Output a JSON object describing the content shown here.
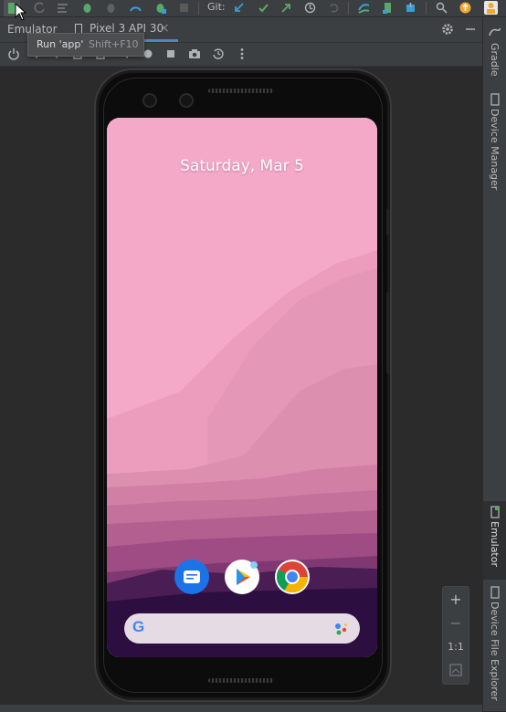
{
  "toolbar": {
    "git_label": "Git:",
    "icons": [
      "run-icon",
      "debug-icon",
      "coverage-icon",
      "profile-icon",
      "attach-debugger-icon",
      "apply-changes-icon",
      "stop-icon",
      "update-icon",
      "commit-icon",
      "push-icon",
      "history-icon",
      "rollback-icon",
      "sync-icon",
      "device-manager-icon",
      "sdk-icon",
      "search-icon",
      "updates-icon",
      "avatar-icon"
    ]
  },
  "tabs": {
    "emulator_label": "Emulator",
    "device_tab_label": "Pixel 3 API 30",
    "close_glyph": "×"
  },
  "tooltip": {
    "action": "Run 'app'",
    "shortcut": "Shift+F10"
  },
  "right_strip": {
    "gradle": "Gradle",
    "device_manager": "Device Manager",
    "emulator": "Emulator",
    "device_file_explorer": "Device File Explorer"
  },
  "phone": {
    "date": "Saturday, Mar 5",
    "dock_apps": [
      "Messages",
      "Play Store",
      "Chrome"
    ],
    "search_logo": "G"
  },
  "zoom": {
    "plus": "+",
    "minus": "−",
    "ratio": "1:1"
  },
  "colors": {
    "ide_bg": "#2b2b2b",
    "panel_bg": "#3c3f41",
    "accent_blue": "#4a88c7",
    "wallpaper_top": "#f4a9c8",
    "wallpaper_bottom": "#2c0f40"
  }
}
